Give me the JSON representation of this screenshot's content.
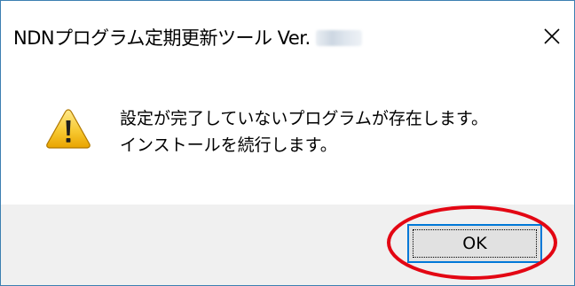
{
  "dialog": {
    "title": "NDNプログラム定期更新ツール Ver.",
    "message_lines": [
      "設定が完了していないプログラムが存在します。",
      "インストールを続行します。"
    ],
    "ok_label": "OK",
    "icons": {
      "close": "close-icon",
      "warning": "warning-icon"
    }
  },
  "annotation": {
    "highlight_color": "#e30613",
    "highlight_target": "ok-button"
  }
}
